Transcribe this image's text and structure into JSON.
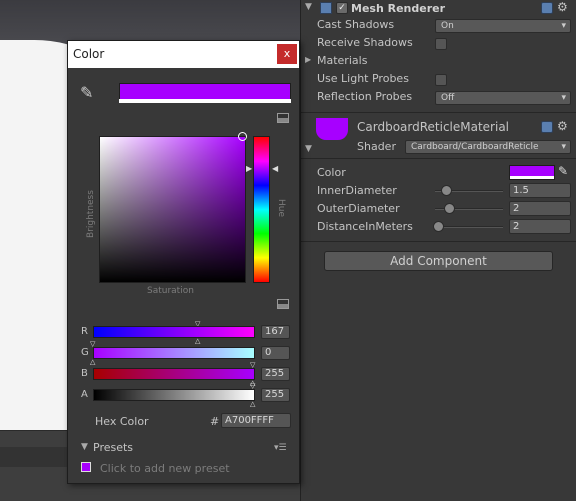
{
  "colors": {
    "selected": "#A700FF",
    "accent": "#5a7fb0"
  },
  "inspector": {
    "mesh_renderer_title": "Mesh Renderer",
    "rows": [
      {
        "label": "Cast Shadows",
        "value": "On"
      },
      {
        "label": "Receive Shadows"
      },
      {
        "label": "Materials"
      },
      {
        "label": "Use Light Probes"
      },
      {
        "label": "Reflection Probes",
        "value": "Off"
      }
    ],
    "material": {
      "name": "CardboardReticleMaterial",
      "shader_label": "Shader",
      "shader_value": "Cardboard/CardboardReticle",
      "props": [
        {
          "label": "Color"
        },
        {
          "label": "InnerDiameter",
          "value": "1.5",
          "level": 0.05
        },
        {
          "label": "OuterDiameter",
          "value": "2",
          "level": 0.1
        },
        {
          "label": "DistanceInMeters",
          "value": "2",
          "level": 0.02
        }
      ]
    },
    "add_component": "Add Component"
  },
  "color_picker": {
    "title": "Color",
    "close": "x",
    "sv_label_v": "Brightness",
    "sv_label_h": "Saturation",
    "hue_label": "Hue",
    "channels": [
      {
        "name": "R",
        "value": "167"
      },
      {
        "name": "G",
        "value": "0"
      },
      {
        "name": "B",
        "value": "255"
      },
      {
        "name": "A",
        "value": "255"
      }
    ],
    "hex_label": "Hex Color",
    "hex_hash": "#",
    "hex_value": "A700FFFF",
    "presets_label": "Presets",
    "presets_hint": "Click to add new preset"
  }
}
